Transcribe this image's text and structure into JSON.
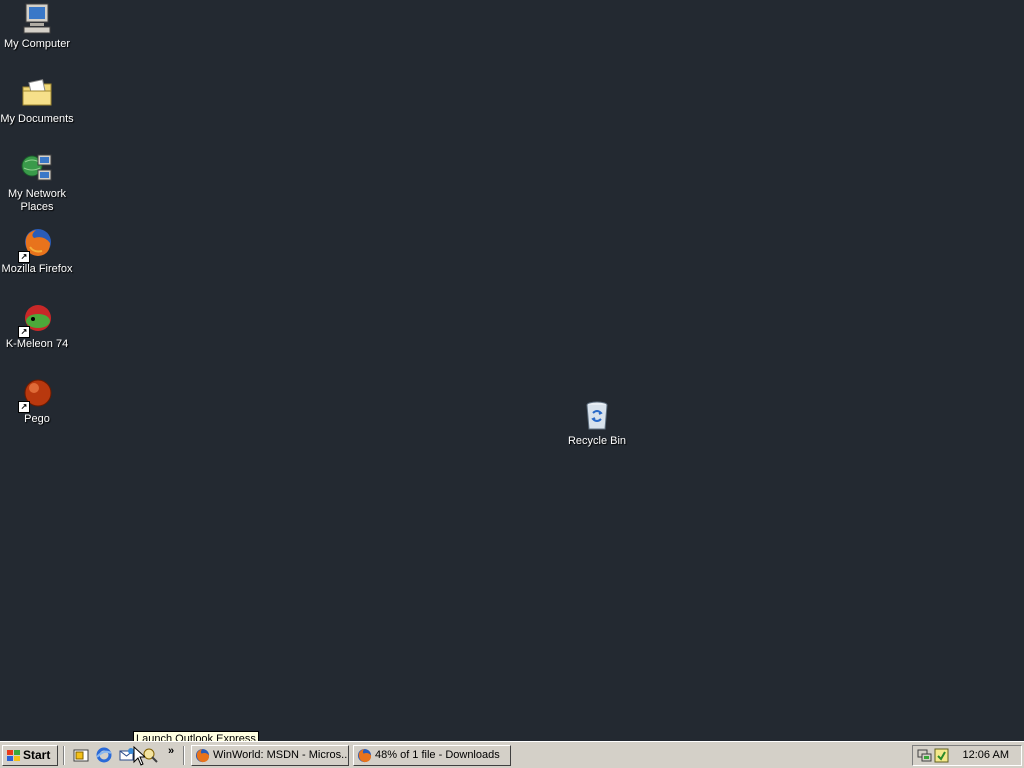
{
  "desktop": {
    "background_color": "#232931",
    "icons": [
      {
        "label": "My Computer",
        "icon": "computer-icon"
      },
      {
        "label": "My Documents",
        "icon": "folder-icon"
      },
      {
        "label": "My Network Places",
        "icon": "network-icon"
      },
      {
        "label": "Mozilla Firefox",
        "icon": "firefox-icon",
        "shortcut": true
      },
      {
        "label": "K-Meleon 74",
        "icon": "kmeleon-icon",
        "shortcut": true
      },
      {
        "label": "Pego",
        "icon": "pego-icon",
        "shortcut": true
      },
      {
        "label": "Recycle Bin",
        "icon": "recycle-bin-icon"
      }
    ]
  },
  "taskbar": {
    "start_label": "Start",
    "quick_launch": [
      {
        "name": "show-desktop-icon"
      },
      {
        "name": "internet-explorer-icon"
      },
      {
        "name": "outlook-express-icon"
      },
      {
        "name": "media-icon"
      }
    ],
    "more_label": "»",
    "tasks": [
      {
        "label": "WinWorld: MSDN - Micros...",
        "icon": "firefox-icon",
        "active": false
      },
      {
        "label": "48% of 1 file - Downloads",
        "icon": "firefox-icon",
        "active": false
      }
    ],
    "clock": "12:06 AM"
  },
  "tooltip": {
    "text": "Launch Outlook Express"
  }
}
